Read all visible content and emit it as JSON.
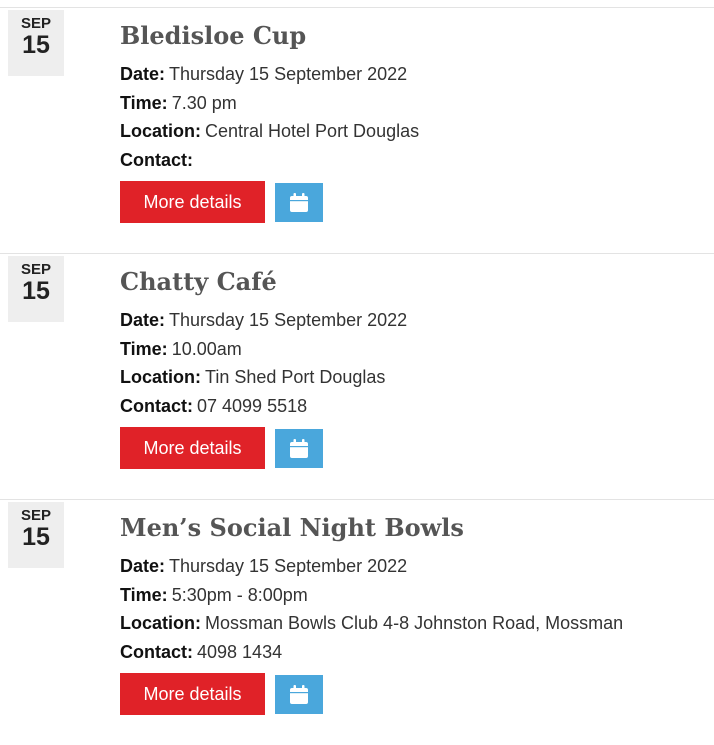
{
  "events": [
    {
      "month": "SEP",
      "day": "15",
      "title": "Bledisloe Cup",
      "date_label": "Date:",
      "date_value": "Thursday 15 September 2022",
      "time_label": "Time:",
      "time_value": "7.30 pm",
      "location_label": "Location:",
      "location_value": "Central Hotel Port Douglas",
      "contact_label": "Contact:",
      "contact_value": "",
      "more_label": "More details",
      "calendar_icon": "calendar-icon"
    },
    {
      "month": "SEP",
      "day": "15",
      "title": "Chatty Café",
      "date_label": "Date:",
      "date_value": "Thursday 15 September 2022",
      "time_label": "Time:",
      "time_value": "10.00am",
      "location_label": "Location:",
      "location_value": "Tin Shed Port Douglas",
      "contact_label": "Contact:",
      "contact_value": "07 4099 5518",
      "more_label": "More details",
      "calendar_icon": "calendar-icon"
    },
    {
      "month": "SEP",
      "day": "15",
      "title": "Men’s Social Night Bowls",
      "date_label": "Date:",
      "date_value": "Thursday 15 September 2022",
      "time_label": "Time:",
      "time_value": "5:30pm - 8:00pm",
      "location_label": "Location:",
      "location_value": "Mossman Bowls Club 4-8 Johnston Road, Mossman",
      "contact_label": "Contact:",
      "contact_value": "4098 1434",
      "more_label": "More details",
      "calendar_icon": "calendar-icon"
    }
  ],
  "colors": {
    "more_button": "#e02228",
    "calendar_button": "#4aa7dc",
    "date_badge_bg": "#eeeeee",
    "title_text": "#555555"
  }
}
